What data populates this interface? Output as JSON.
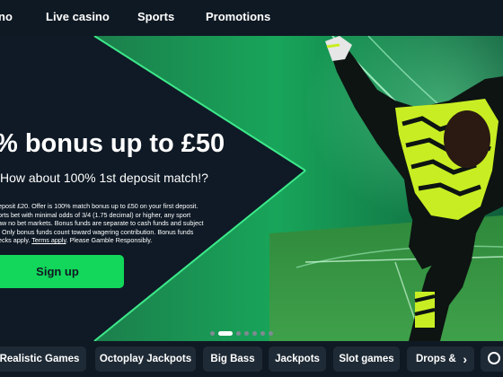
{
  "nav": {
    "items": [
      {
        "label": "no"
      },
      {
        "label": "Live casino"
      },
      {
        "label": "Sports"
      },
      {
        "label": "Promotions"
      }
    ]
  },
  "hero": {
    "title": "% bonus up to £50",
    "subtitle": "How about 100% 1st deposit match!?",
    "terms_lines": [
      "eposit £20. Offer is 100% match bonus up to £50 on your first deposit.",
      "orts bet with minimal odds of 3/4 (1.75 decimal) or higher, any sport",
      "aw no bet markets. Bonus funds are separate to cash funds and subject",
      ". Only bonus funds count toward wagering contribution. Bonus funds"
    ],
    "terms_last_prefix": "ecks apply. ",
    "terms_link": "Terms apply",
    "terms_last_suffix": ". Please Gamble Responsibly.",
    "cta_label": "Sign up",
    "slide_count": 7,
    "active_slide": 1,
    "accent_color": "#12d75a"
  },
  "categories": {
    "chips": [
      {
        "label": "Realistic Games"
      },
      {
        "label": "Octoplay Jackpots"
      },
      {
        "label": "Big Bass"
      },
      {
        "label": "Jackpots"
      },
      {
        "label": "Slot games"
      },
      {
        "label": "Drops &"
      }
    ],
    "next_icon": "chevron-right-icon",
    "search_icon": "search-icon"
  }
}
